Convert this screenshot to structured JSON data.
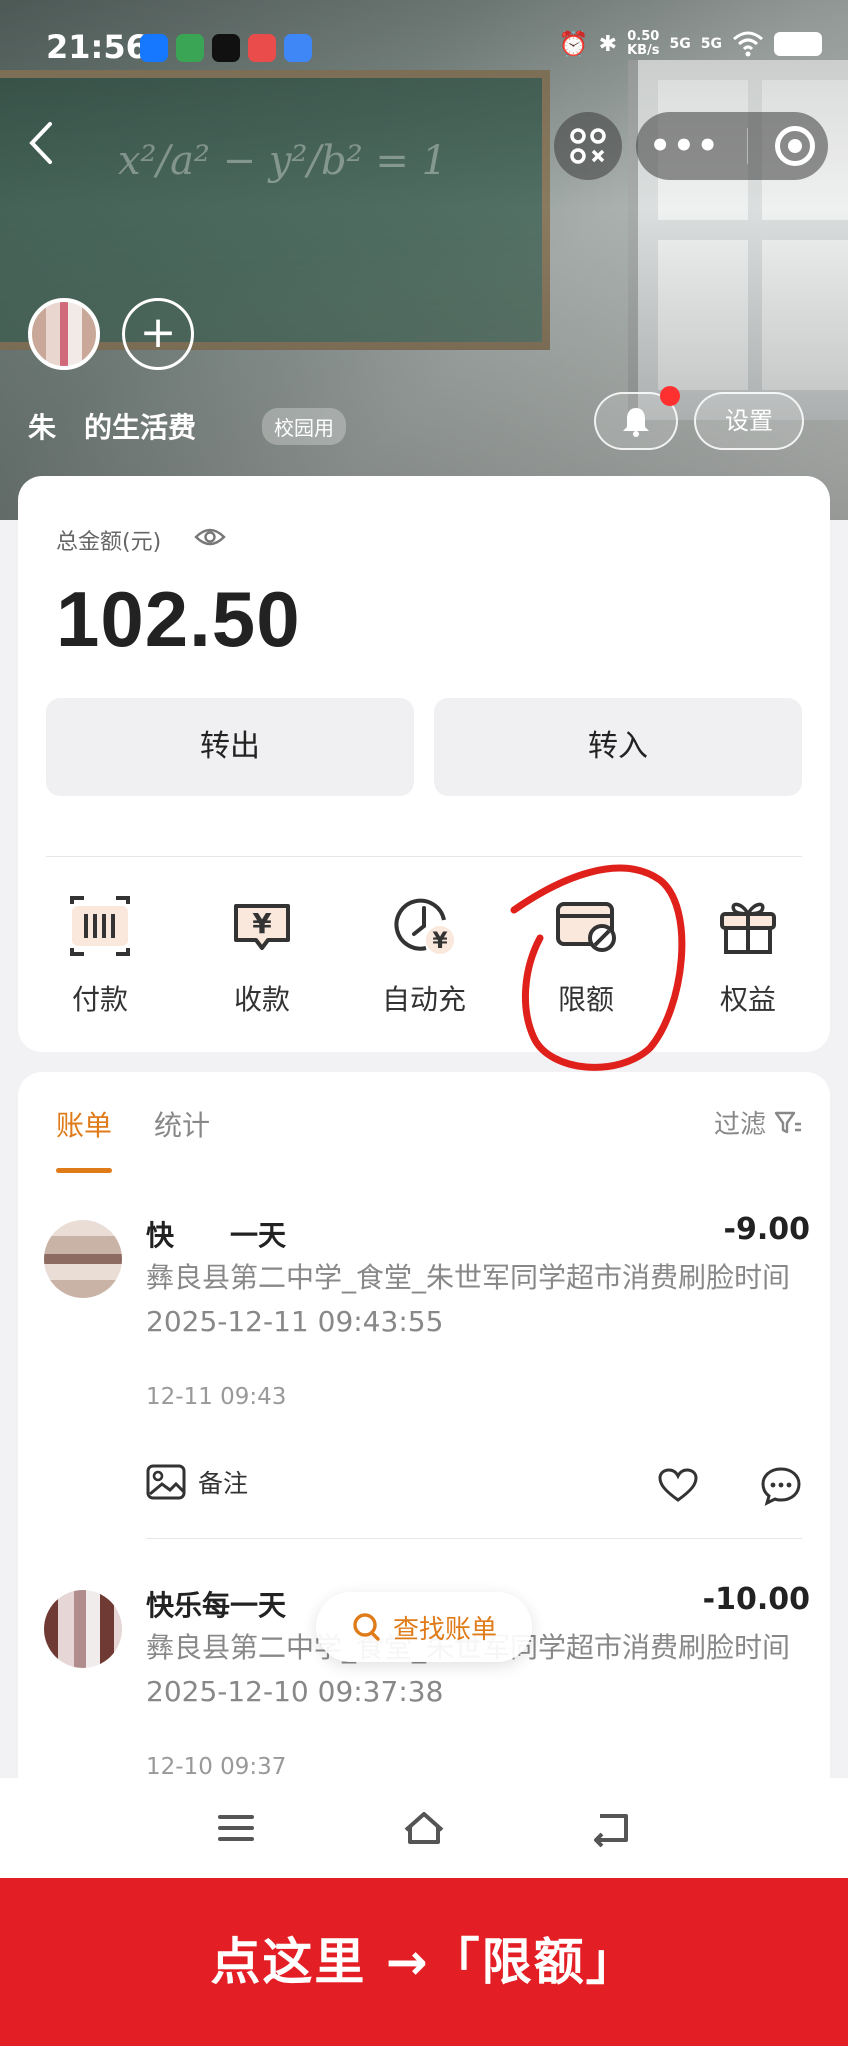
{
  "status_bar": {
    "time": "21:56",
    "net_speed_value": "0.50",
    "net_speed_unit": "KB/s",
    "signal_1": "5G",
    "signal_2": "5G"
  },
  "header": {
    "account_name": "朱  的生活费",
    "badge": "校园用",
    "settings_label": "设置"
  },
  "balance": {
    "label": "总金额(元)",
    "amount": "102.50",
    "transfer_out": "转出",
    "transfer_in": "转入"
  },
  "tools": [
    {
      "label": "付款",
      "icon": "payment-code-icon"
    },
    {
      "label": "收款",
      "icon": "receive-yuan-icon"
    },
    {
      "label": "自动充",
      "icon": "auto-recharge-icon"
    },
    {
      "label": "限额",
      "icon": "limit-card-icon"
    },
    {
      "label": "权益",
      "icon": "gift-icon"
    }
  ],
  "bills": {
    "tabs": [
      "账单",
      "统计"
    ],
    "filter_label": "过滤",
    "items": [
      {
        "title": "快    一天",
        "amount": "-9.00",
        "desc": "彝良县第二中学_食堂_朱世军同学超市消费刷脸时间2025-12-11 09:43:55",
        "time": "12-11 09:43",
        "note_label": "备注"
      },
      {
        "title": "快乐每一天",
        "amount": "-10.00",
        "desc": "彝良县第二中学_食堂_朱世军同学超市消费刷脸时间2025-12-10 09:37:38",
        "time": "12-10 09:37"
      }
    ],
    "find_label": "查找账单"
  },
  "banner": {
    "text": "点这里 →「限额」"
  },
  "colors": {
    "accent": "#e07b1a",
    "banner_red": "#e31e24",
    "annotation_red": "#e0201a"
  }
}
